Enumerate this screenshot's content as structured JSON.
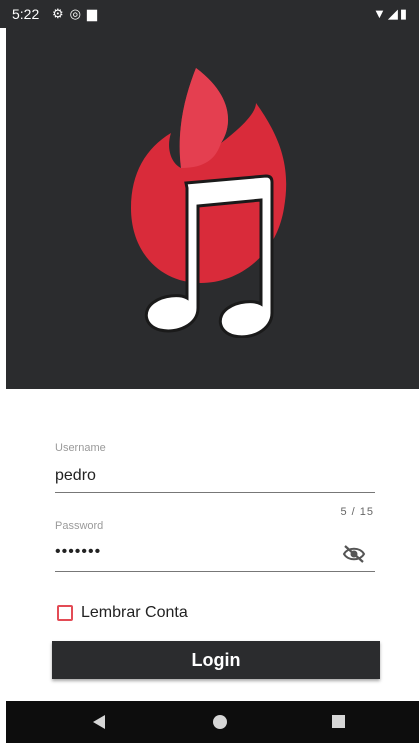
{
  "status_bar": {
    "time": "5:22",
    "left_icons": [
      "gear-icon",
      "vpn-icon",
      "sd-card-icon"
    ],
    "right_icons": [
      "wifi-icon",
      "signal-icon",
      "battery-icon"
    ]
  },
  "logo": {
    "icon": "flame-music-note-logo",
    "flame_color": "#d92b3a",
    "note_color": "#ffffff"
  },
  "form": {
    "username": {
      "label": "Username",
      "value": "pedro",
      "counter": "5 / 15"
    },
    "password": {
      "label": "Password",
      "value": "•••••••",
      "toggle_icon": "eye-off-icon"
    },
    "remember": {
      "label": "Lembrar Conta",
      "checked": false
    },
    "login_button": "Login"
  },
  "nav_bar": {
    "back": "back-icon",
    "home": "home-icon",
    "recents": "recents-icon"
  },
  "colors": {
    "dark": "#2b2c2e",
    "accent": "#e34b55"
  }
}
